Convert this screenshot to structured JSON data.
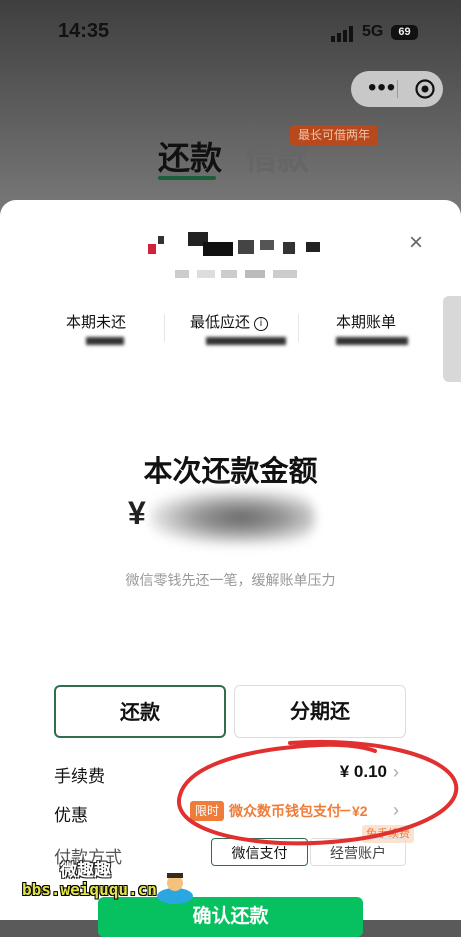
{
  "status_bar": {
    "time": "14:35",
    "network": "5G",
    "battery": "69"
  },
  "capsule": {
    "more_label": "•••"
  },
  "tabs": {
    "repay": "还款",
    "borrow": "借款",
    "borrow_badge": "最长可借两年"
  },
  "summary": {
    "close_label": "×",
    "current_unpaid_label": "本期未还",
    "min_due_label": "最低应还",
    "info_label": "i",
    "current_bill_label": "本期账单"
  },
  "amount": {
    "title": "本次还款金额",
    "currency": "¥",
    "hint": "微信零钱先还一笔，缓解账单压力"
  },
  "options": {
    "repay": "还款",
    "installment": "分期还"
  },
  "fee": {
    "label": "手续费",
    "value": "¥ 0.10"
  },
  "discount": {
    "label": "优惠",
    "tag": "限时",
    "text": "微众数币钱包支付",
    "amount": "－¥2",
    "free_tag": "免手续费"
  },
  "payment": {
    "label": "付款方式",
    "wechat": "微信支付",
    "bank": "经营账户"
  },
  "confirm": {
    "label": "确认还款"
  },
  "watermark": {
    "title": "微趣趣",
    "url": "bbs.weiququ.cn"
  },
  "colors": {
    "accent_green": "#07c160",
    "tab_green": "#1c5e3b",
    "promo_orange": "#f07c3a",
    "annotation_red": "#e03030"
  }
}
